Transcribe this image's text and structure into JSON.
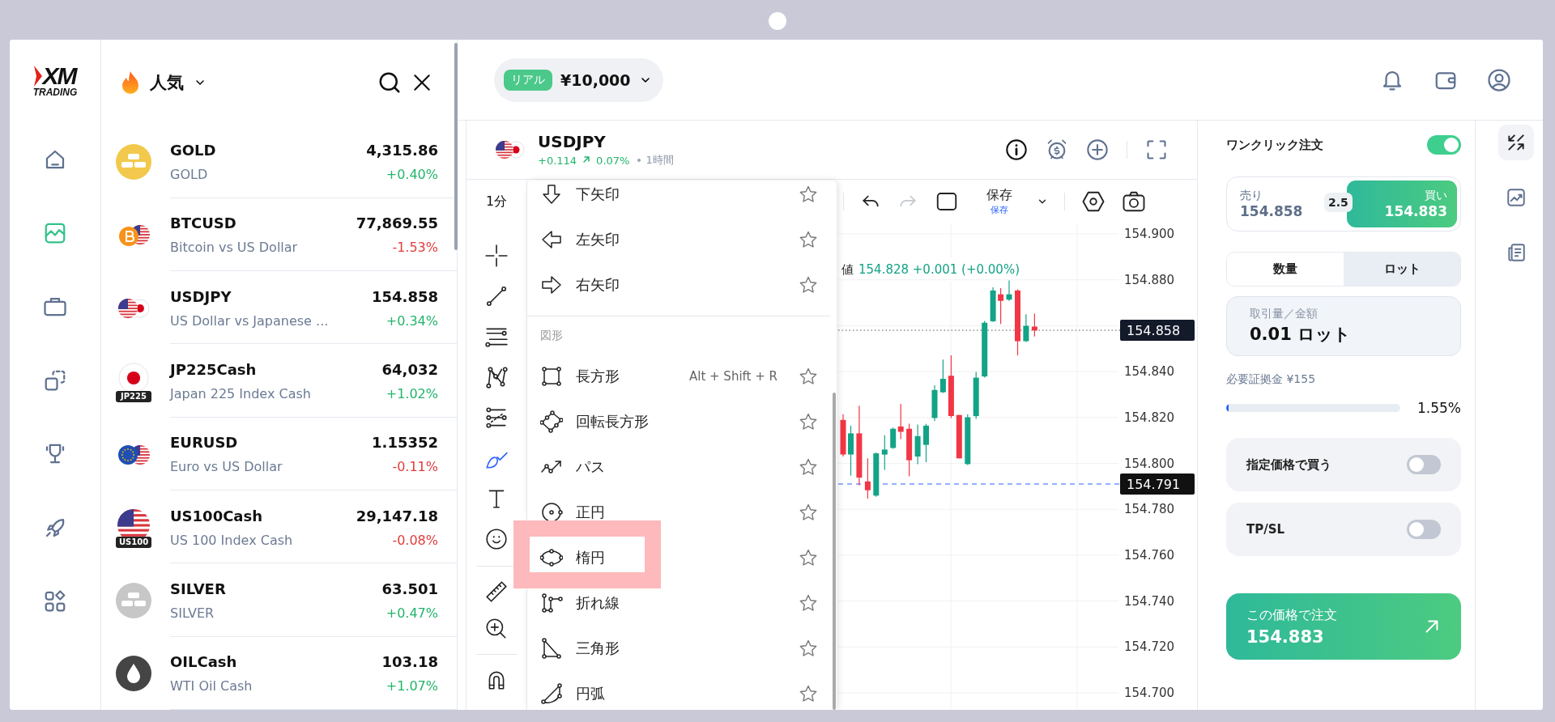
{
  "logo": {
    "mark": "XM",
    "subtitle": "TRADING"
  },
  "nav": [
    {
      "selected": false
    },
    {
      "selected": true
    },
    {
      "selected": false
    },
    {
      "selected": false
    },
    {
      "selected": false
    },
    {
      "selected": false
    },
    {
      "selected": false
    }
  ],
  "market_list": {
    "title": "人気",
    "items": [
      {
        "symbol": "GOLD",
        "description": "GOLD",
        "price": "4,315.86",
        "change": "+0.40%",
        "falling": false
      },
      {
        "symbol": "BTCUSD",
        "description": "Bitcoin vs US Dollar",
        "price": "77,869.55",
        "change": "-1.53%",
        "falling": true
      },
      {
        "symbol": "USDJPY",
        "description": "US Dollar vs Japanese ...",
        "price": "154.858",
        "change": "+0.34%",
        "falling": false
      },
      {
        "symbol": "JP225Cash",
        "description": "Japan 225 Index Cash",
        "price": "64,032",
        "change": "+1.02%",
        "falling": false,
        "badge": "JP225"
      },
      {
        "symbol": "EURUSD",
        "description": "Euro vs US Dollar",
        "price": "1.15352",
        "change": "-0.11%",
        "falling": true
      },
      {
        "symbol": "US100Cash",
        "description": "US 100 Index Cash",
        "price": "29,147.18",
        "change": "-0.08%",
        "falling": true,
        "badge": "US100"
      },
      {
        "symbol": "SILVER",
        "description": "SILVER",
        "price": "63.501",
        "change": "+0.47%",
        "falling": false
      },
      {
        "symbol": "OILCash",
        "description": "WTI Oil Cash",
        "price": "103.18",
        "change": "+1.07%",
        "falling": false
      }
    ]
  },
  "account": {
    "badge": "リアル",
    "balance": "¥10,000"
  },
  "chart": {
    "symbol": "USDJPY",
    "change": "+0.114",
    "change_percent": "0.07%",
    "interval": "1時間",
    "timeframe": "1分",
    "tools": [
      {
        "selected": false
      },
      {
        "selected": false
      },
      {
        "selected": false
      },
      {
        "selected": false
      },
      {
        "selected": false
      },
      {
        "selected": true
      },
      {
        "selected": false
      },
      {
        "selected": false
      },
      {
        "selected": false
      },
      {
        "selected": false
      },
      {
        "selected": false
      }
    ],
    "undo": {
      "disabled": false
    },
    "redo": {
      "disabled": true
    },
    "save": {
      "label": "保存",
      "sublabel": "保存"
    },
    "legend": {
      "label": "値",
      "values": "154.828 +0.001 (+0.00%)"
    },
    "price_axis": [
      "154.900",
      "154.880",
      "154.840",
      "154.820",
      "154.800",
      "154.780",
      "154.760",
      "154.740",
      "154.720",
      "154.700"
    ],
    "price_tags": [
      {
        "text": "154.858",
        "kind": "last"
      },
      {
        "text": "154.791",
        "kind": "bid"
      }
    ]
  },
  "drawing_menu": {
    "items": [
      {
        "kind": "item",
        "label": "下矢印",
        "starred": false,
        "highlighted": false
      },
      {
        "kind": "item",
        "label": "左矢印",
        "starred": false,
        "highlighted": false
      },
      {
        "kind": "item",
        "label": "右矢印",
        "starred": false,
        "highlighted": false
      },
      {
        "kind": "divider"
      },
      {
        "kind": "header",
        "label": "図形"
      },
      {
        "kind": "item",
        "label": "長方形",
        "shortcut": "Alt + Shift + R",
        "starred": false,
        "highlighted": false
      },
      {
        "kind": "item",
        "label": "回転長方形",
        "starred": false,
        "highlighted": false
      },
      {
        "kind": "item",
        "label": "パス",
        "starred": false,
        "highlighted": false
      },
      {
        "kind": "item",
        "label": "正円",
        "starred": false,
        "highlighted": false
      },
      {
        "kind": "item",
        "label": "楕円",
        "starred": false,
        "highlighted": true
      },
      {
        "kind": "item",
        "label": "折れ線",
        "starred": false,
        "highlighted": false
      },
      {
        "kind": "item",
        "label": "三角形",
        "starred": false,
        "highlighted": false
      },
      {
        "kind": "item",
        "label": "円弧",
        "starred": false,
        "highlighted": false
      }
    ]
  },
  "order_panel": {
    "one_click": {
      "label": "ワンクリック注文",
      "on": true
    },
    "sell": {
      "label": "売り",
      "price": "154.858",
      "selected": false
    },
    "spread": "2.5",
    "buy": {
      "label": "買い",
      "price": "154.883",
      "selected": true
    },
    "units": [
      {
        "label": "数量",
        "selected": false
      },
      {
        "label": "ロット",
        "selected": true
      }
    ],
    "volume": {
      "label": "取引量／金額",
      "value": "0.01 ロット"
    },
    "margin": {
      "label": "必要証拠金 ¥155",
      "level": 0.0155,
      "percent": "1.55%"
    },
    "options": [
      {
        "label": "指定価格で買う",
        "on": false
      },
      {
        "label": "TP/SL",
        "on": false
      }
    ],
    "submit": {
      "label": "この価格で注文",
      "price": "154.883"
    }
  },
  "right_rail": [
    {
      "selected": true
    },
    {
      "selected": false
    },
    {
      "selected": false
    }
  ]
}
